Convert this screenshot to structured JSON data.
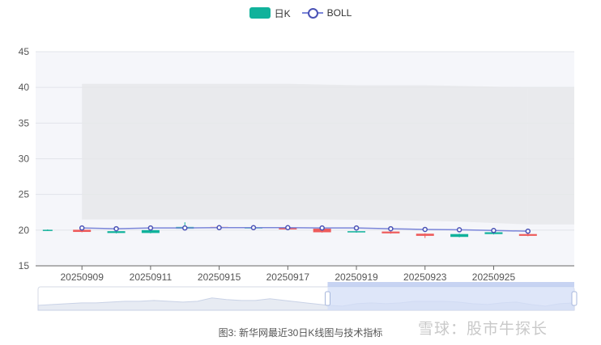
{
  "legend": {
    "kline_label": "日K",
    "boll_label": "BOLL"
  },
  "caption": "图3: 新华网最近30日K线图与技术指标",
  "watermark": "雪球：股市牛探长",
  "colors": {
    "up": "#ee5b5b",
    "down": "#10b29b",
    "boll_line": "#7b86d9",
    "boll_marker": "#4a52b5",
    "band": "#e6e7ea",
    "slider_sel": "#d3ddf7"
  },
  "chart_data": {
    "type": "candlestick",
    "x_tick_labels": [
      "20250909",
      "20250911",
      "20250915",
      "20250917",
      "20250919",
      "20250923",
      "20250925"
    ],
    "y_ticks": [
      15,
      20,
      25,
      30,
      35,
      40,
      45
    ],
    "ylim": [
      15,
      45
    ],
    "categories": [
      "20250908",
      "20250909",
      "20250910",
      "20250911",
      "20250912",
      "20250915",
      "20250916",
      "20250917",
      "20250918",
      "20250919",
      "20250922",
      "20250923",
      "20250924",
      "20250925",
      "20250926"
    ],
    "candles": [
      {
        "open": 20.05,
        "close": 19.95,
        "low": 19.9,
        "high": 20.1
      },
      {
        "open": 19.75,
        "close": 20.05,
        "low": 19.7,
        "high": 20.15
      },
      {
        "open": 19.85,
        "close": 19.6,
        "low": 19.55,
        "high": 19.9
      },
      {
        "open": 20.0,
        "close": 19.6,
        "low": 19.55,
        "high": 20.05
      },
      {
        "open": 20.45,
        "close": 20.2,
        "low": 20.1,
        "high": 21.1
      },
      {
        "open": 20.3,
        "close": 20.45,
        "low": 20.25,
        "high": 20.5
      },
      {
        "open": 20.4,
        "close": 20.25,
        "low": 20.2,
        "high": 20.45
      },
      {
        "open": 20.1,
        "close": 20.35,
        "low": 20.05,
        "high": 20.4
      },
      {
        "open": 19.7,
        "close": 20.2,
        "low": 19.65,
        "high": 20.3
      },
      {
        "open": 19.85,
        "close": 19.7,
        "low": 19.65,
        "high": 19.9
      },
      {
        "open": 19.55,
        "close": 19.8,
        "low": 19.5,
        "high": 19.85
      },
      {
        "open": 19.2,
        "close": 19.5,
        "low": 18.9,
        "high": 19.55
      },
      {
        "open": 19.45,
        "close": 19.05,
        "low": 19.0,
        "high": 19.5
      },
      {
        "open": 19.7,
        "close": 19.45,
        "low": 19.4,
        "high": 19.75
      },
      {
        "open": 19.2,
        "close": 19.45,
        "low": 19.15,
        "high": 19.5
      }
    ],
    "boll_mid": [
      null,
      20.3,
      20.2,
      20.3,
      20.3,
      20.35,
      20.35,
      20.35,
      20.3,
      20.3,
      20.2,
      20.1,
      20.05,
      19.95,
      19.85
    ],
    "boll_upper": [
      null,
      40.5,
      40.5,
      40.5,
      40.5,
      40.5,
      40.5,
      40.5,
      40.4,
      40.3,
      40.3,
      40.3,
      40.2,
      40.1,
      40.0
    ],
    "boll_lower": [
      null,
      21.5,
      21.5,
      21.5,
      21.5,
      21.5,
      21.5,
      21.5,
      21.5,
      21.45,
      21.4,
      21.3,
      21.2,
      21.0,
      20.8
    ],
    "slider_range": [
      0.54,
      1.0
    ]
  }
}
